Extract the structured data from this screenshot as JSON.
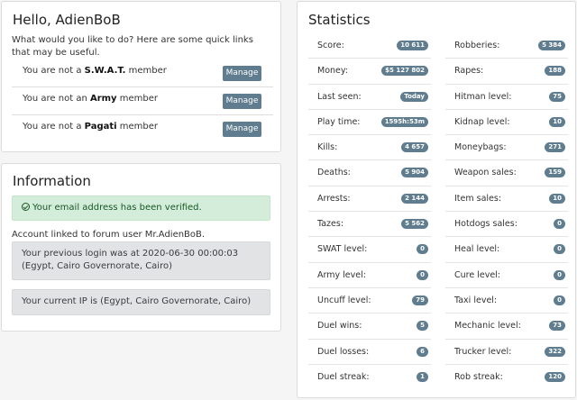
{
  "hello": {
    "title": "Hello, AdienBoB",
    "intro": "What would you like to do? Here are some quick links that may be useful.",
    "memberships": [
      {
        "prefix": "You are not a ",
        "group": "S.W.A.T.",
        "suffix": " member",
        "button": "Manage"
      },
      {
        "prefix": "You are not an ",
        "group": "Army",
        "suffix": " member",
        "button": "Manage"
      },
      {
        "prefix": "You are not a ",
        "group": "Pagati",
        "suffix": " member",
        "button": "Manage"
      }
    ]
  },
  "information": {
    "title": "Information",
    "email_verified": "Your email address has been verified.",
    "forum_link": "Account linked to forum user Mr.AdienBoB.",
    "previous_login": "Your previous login was at 2020-06-30 00:00:03 (Egypt, Cairo Governorate, Cairo)",
    "current_ip": "Your current IP is (Egypt, Cairo Governorate, Cairo)",
    "colors": {
      "success_bg": "#d4edda",
      "info_bg": "#e2e3e5"
    }
  },
  "statistics": {
    "title": "Statistics",
    "badge_color": "#5f7d8f",
    "left": [
      {
        "label": "Score:",
        "value": "10 611"
      },
      {
        "label": "Money:",
        "value": "$5 127 802"
      },
      {
        "label": "Last seen:",
        "value": "Today"
      },
      {
        "label": "Play time:",
        "value": "1595h:53m"
      },
      {
        "label": "Kills:",
        "value": "4 657"
      },
      {
        "label": "Deaths:",
        "value": "5 904"
      },
      {
        "label": "Arrests:",
        "value": "2 144"
      },
      {
        "label": "Tazes:",
        "value": "5 562"
      },
      {
        "label": "SWAT level:",
        "value": "0"
      },
      {
        "label": "Army level:",
        "value": "0"
      },
      {
        "label": "Uncuff level:",
        "value": "79"
      },
      {
        "label": "Duel wins:",
        "value": "5"
      },
      {
        "label": "Duel losses:",
        "value": "6"
      },
      {
        "label": "Duel streak:",
        "value": "1"
      }
    ],
    "right": [
      {
        "label": "Robberies:",
        "value": "5 384"
      },
      {
        "label": "Rapes:",
        "value": "188"
      },
      {
        "label": "Hitman level:",
        "value": "75"
      },
      {
        "label": "Kidnap level:",
        "value": "10"
      },
      {
        "label": "Moneybags:",
        "value": "271"
      },
      {
        "label": "Weapon sales:",
        "value": "159"
      },
      {
        "label": "Item sales:",
        "value": "10"
      },
      {
        "label": "Hotdogs sales:",
        "value": "0"
      },
      {
        "label": "Heal level:",
        "value": "0"
      },
      {
        "label": "Cure level:",
        "value": "0"
      },
      {
        "label": "Taxi level:",
        "value": "0"
      },
      {
        "label": "Mechanic level:",
        "value": "73"
      },
      {
        "label": "Trucker level:",
        "value": "322"
      },
      {
        "label": "Rob streak:",
        "value": "120"
      }
    ]
  }
}
